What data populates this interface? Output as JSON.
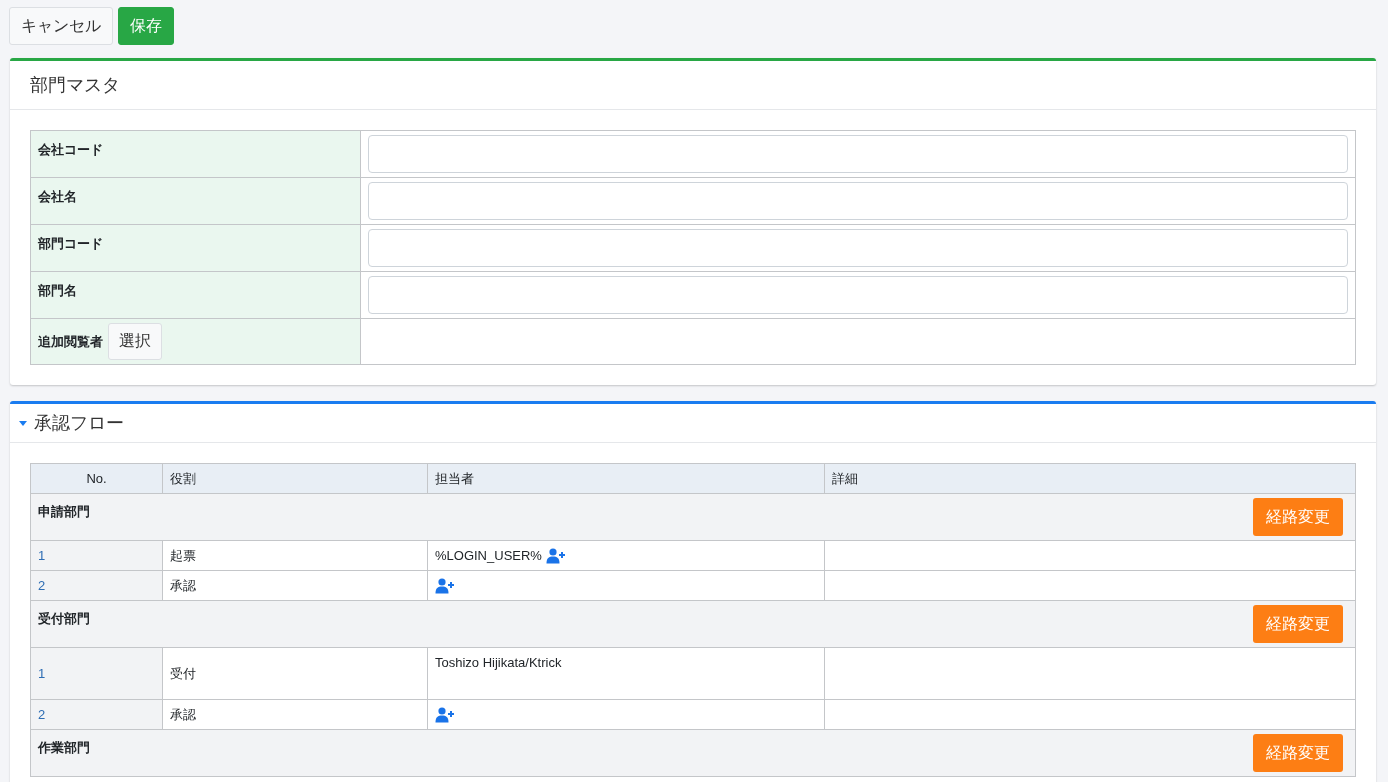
{
  "toolbar": {
    "buttons": [
      {
        "label": "キャンセル",
        "kind": "secondary"
      },
      {
        "label": "保存",
        "kind": "primary"
      }
    ]
  },
  "master": {
    "title": "部門マスタ",
    "fields": [
      {
        "label": "会社コード",
        "kind": "input"
      },
      {
        "label": "会社名",
        "kind": "input"
      },
      {
        "label": "部門コード",
        "kind": "input"
      },
      {
        "label": "部門名",
        "kind": "input"
      },
      {
        "label": "追加閲覧者",
        "kind": "select",
        "button": "選択"
      }
    ]
  },
  "flow": {
    "title": "承認フロー",
    "expanded": true,
    "columns": [
      "No.",
      "役割",
      "担当者",
      "詳細"
    ],
    "groups": [
      {
        "name": "申請部門",
        "button": "経路変更",
        "rows": [
          {
            "no": "1",
            "role": "起票",
            "assignee": "%LOGIN_USER%",
            "add_user": true,
            "tall": false
          },
          {
            "no": "2",
            "role": "承認",
            "add_user": true,
            "tall": false
          }
        ]
      },
      {
        "name": "受付部門",
        "button": "経路変更",
        "rows": [
          {
            "no": "1",
            "role": "受付",
            "assignee": "Toshizo Hijikata/Ktrick",
            "add_user": false,
            "tall": true
          },
          {
            "no": "2",
            "role": "承認",
            "add_user": true,
            "tall": false
          }
        ]
      },
      {
        "name": "作業部門",
        "button": "経路変更"
      }
    ]
  }
}
